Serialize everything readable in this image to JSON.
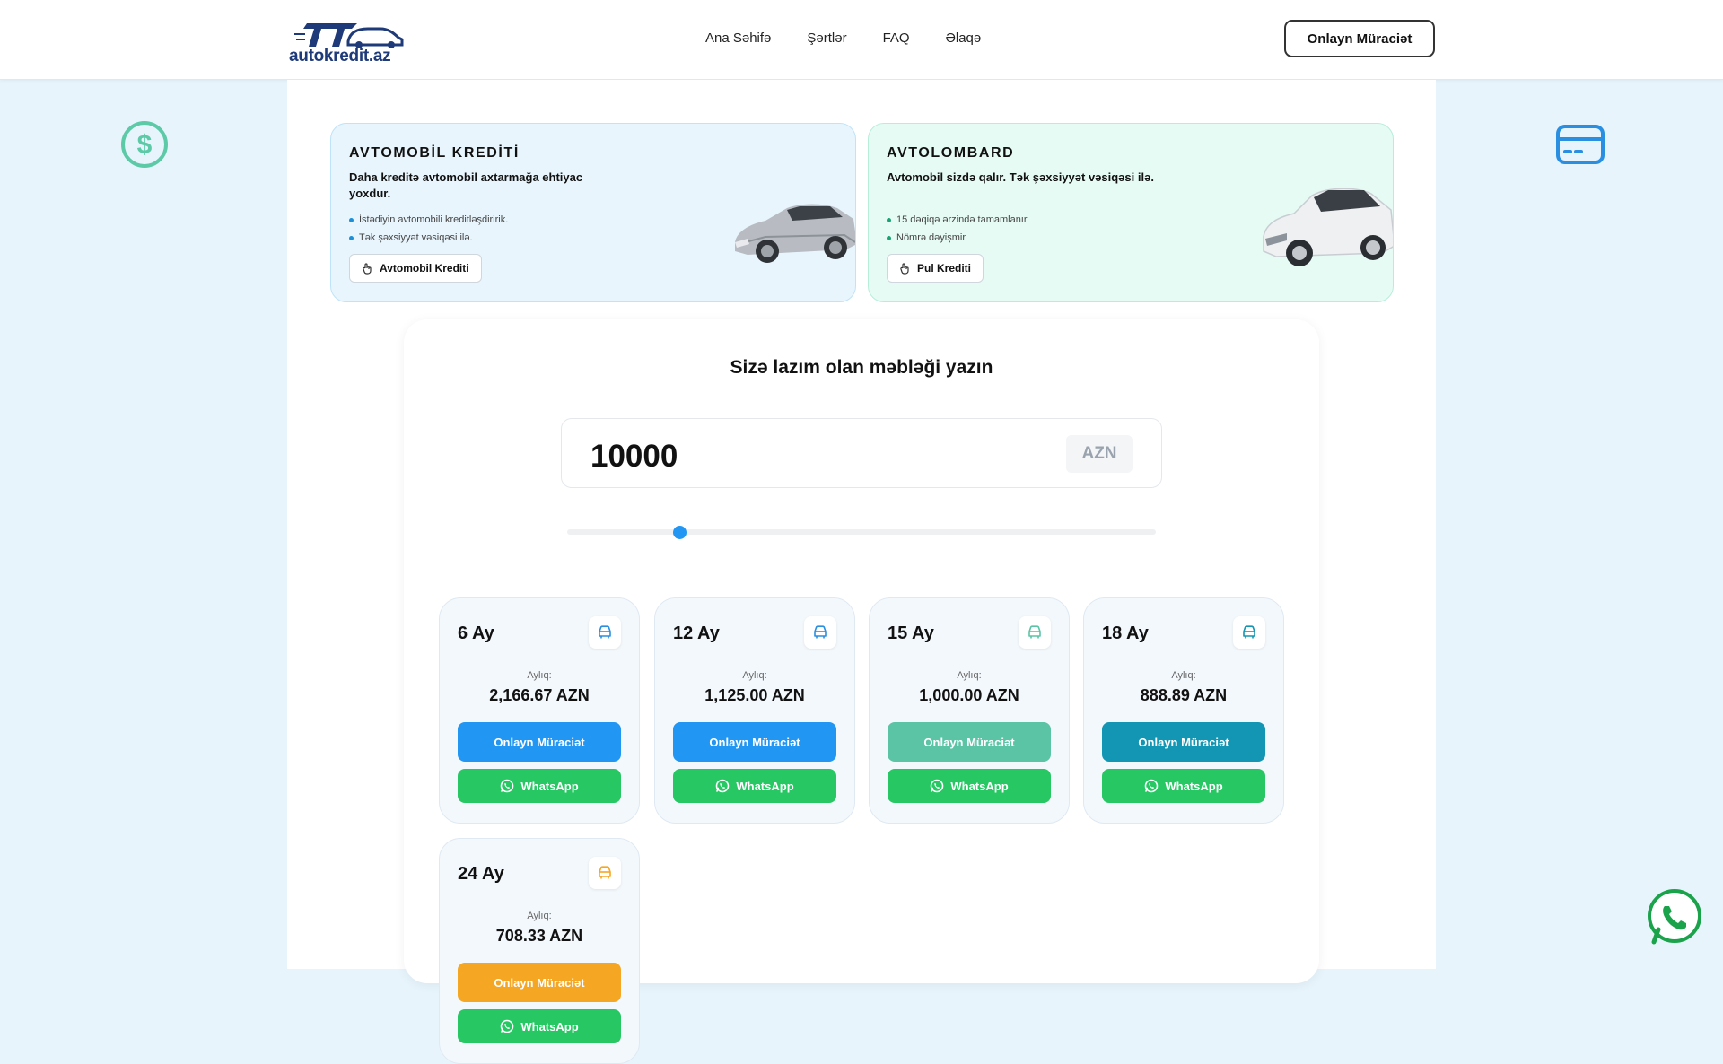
{
  "header": {
    "logo_text": "autokredit.az",
    "nav": [
      "Ana Səhifə",
      "Şərtlər",
      "FAQ",
      "Əlaqə"
    ],
    "cta": "Onlayn Müraciət"
  },
  "side_icons": {
    "left": "dollar-circle-icon",
    "right": "credit-card-icon"
  },
  "promos": [
    {
      "title": "AVTOMOBİL KREDİTİ",
      "subtitle": "Daha kreditə avtomobil axtarmağa ehtiyac yoxdur.",
      "bullets": [
        "İstədiyin avtomobili kreditləşdiririk.",
        "Tək şəxsiyyət vəsiqəsi ilə."
      ],
      "button": "Avtomobil Krediti"
    },
    {
      "title": "AVTOLOMBARD",
      "subtitle": "Avtomobil sizdə qalır. Tək şəxsiyyət vəsiqəsi ilə.",
      "bullets": [
        "15 dəqiqə ərzində tamamlanır",
        "Nömrə dəyişmir"
      ],
      "button": "Pul Krediti"
    }
  ],
  "calculator": {
    "title": "Sizə lazım olan məbləği yazın",
    "amount": "10000",
    "currency": "AZN",
    "slider_fraction": 0.19
  },
  "plans": [
    {
      "months": "6 Ay",
      "label": "Aylıq:",
      "monthly": "2,166.67 AZN",
      "apply": "Onlayn Müraciət",
      "whatsapp": "WhatsApp",
      "color": "#2196f3",
      "icon_color": "#2a8fe0"
    },
    {
      "months": "12 Ay",
      "label": "Aylıq:",
      "monthly": "1,125.00 AZN",
      "apply": "Onlayn Müraciət",
      "whatsapp": "WhatsApp",
      "color": "#2196f3",
      "icon_color": "#2a8fe0"
    },
    {
      "months": "15 Ay",
      "label": "Aylıq:",
      "monthly": "1,000.00 AZN",
      "apply": "Onlayn Müraciət",
      "whatsapp": "WhatsApp",
      "color": "#5bc4a5",
      "icon_color": "#5bc4a5"
    },
    {
      "months": "18 Ay",
      "label": "Aylıq:",
      "monthly": "888.89 AZN",
      "apply": "Onlayn Müraciət",
      "whatsapp": "WhatsApp",
      "color": "#1296b3",
      "icon_color": "#1296b3"
    },
    {
      "months": "24 Ay",
      "label": "Aylıq:",
      "monthly": "708.33 AZN",
      "apply": "Onlayn Müraciət",
      "whatsapp": "WhatsApp",
      "color": "#f5a623",
      "icon_color": "#f5a623"
    }
  ]
}
